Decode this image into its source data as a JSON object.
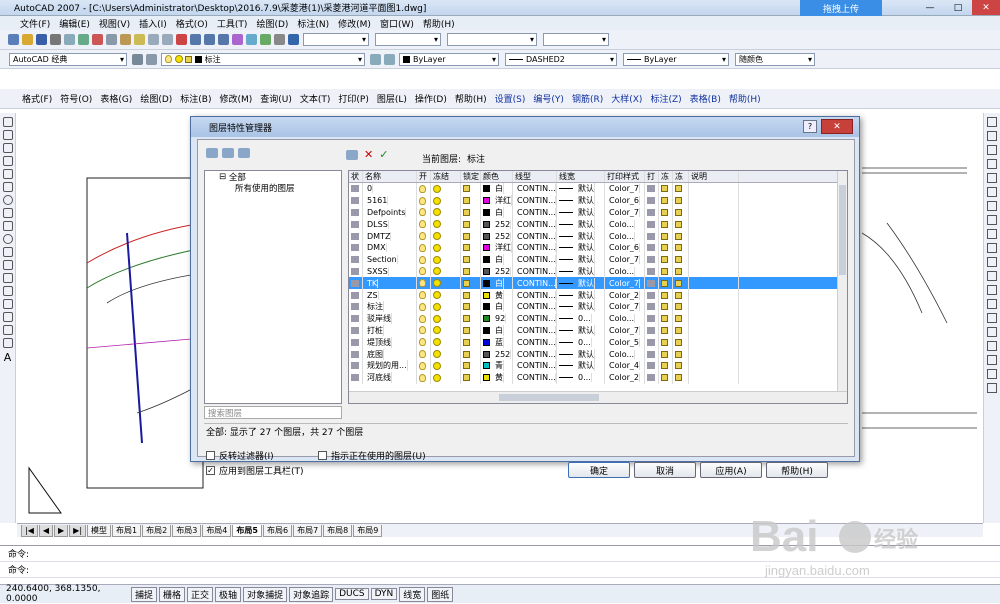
{
  "window": {
    "title": "AutoCAD 2007 - [C:\\Users\\Administrator\\Desktop\\2016.7.9\\采菱港(1)\\采菱港河道平面图1.dwg]",
    "upload_label": "拖拽上传",
    "controls": [
      "—",
      "□",
      "✕"
    ]
  },
  "menu": [
    "文件(F)",
    "编辑(E)",
    "视图(V)",
    "插入(I)",
    "格式(O)",
    "工具(T)",
    "绘图(D)",
    "标注(N)",
    "修改(M)",
    "窗口(W)",
    "帮助(H)"
  ],
  "toolbar2": {
    "workspace": "AutoCAD 经典",
    "layer": "标注",
    "color": "ByLayer",
    "linetype": "DASHED2",
    "lineweight": "ByLayer",
    "plotstyle": "随颜色"
  },
  "toolbar3": [
    "格式(F)",
    "符号(O)",
    "表格(G)",
    "绘图(D)",
    "标注(B)",
    "修改(M)",
    "查询(U)",
    "文本(T)",
    "打印(P)",
    "图层(L)",
    "操作(D)",
    "帮助(H)",
    "设置(S)",
    "编号(Y)",
    "钢筋(R)",
    "大样(X)",
    "标注(Z)",
    "表格(B)",
    "帮助(H)"
  ],
  "layout_tabs": [
    "模型",
    "布局1",
    "布局2",
    "布局3",
    "布局4",
    "布局5",
    "布局6",
    "布局7",
    "布局8",
    "布局9"
  ],
  "layout_nav": [
    "|◀",
    "◀",
    "▶",
    "▶|"
  ],
  "active_tab": "布局5",
  "command_lines": [
    "命令:",
    "命令:"
  ],
  "status": {
    "coords": "240.6400, 368.1350, 0.0000",
    "buttons": [
      "捕捉",
      "栅格",
      "正交",
      "极轴",
      "对象捕捉",
      "对象追踪",
      "DUCS",
      "DYN",
      "线宽",
      "图纸"
    ]
  },
  "dialog": {
    "title": "图层特性管理器",
    "help": "?",
    "close": "✕",
    "current_layer_label": "当前图层:",
    "current_layer": "标注",
    "tree": [
      "全部",
      "所有使用的图层"
    ],
    "search_placeholder": "搜索图层",
    "columns": [
      "状",
      "名称",
      "开",
      "冻结",
      "锁定",
      "颜色",
      "线型",
      "线宽",
      "打印样式",
      "打",
      "冻",
      "冻",
      "说明"
    ],
    "layers": [
      {
        "name": "0",
        "color": "白",
        "swatch": "#000000",
        "linetype": "CONTIN...",
        "lineweight": "默认",
        "plot": "Color_7"
      },
      {
        "name": "5161",
        "color": "洋红",
        "swatch": "#e000e0",
        "linetype": "CONTIN...",
        "lineweight": "默认",
        "plot": "Color_6"
      },
      {
        "name": "Defpoints",
        "color": "白",
        "swatch": "#000000",
        "linetype": "CONTIN...",
        "lineweight": "默认",
        "plot": "Color_7"
      },
      {
        "name": "DLSS",
        "color": "252",
        "swatch": "#555555",
        "linetype": "CONTIN...",
        "lineweight": "默认",
        "plot": "Colo..."
      },
      {
        "name": "DMTZ",
        "color": "252",
        "swatch": "#555555",
        "linetype": "CONTIN...",
        "lineweight": "默认",
        "plot": "Colo..."
      },
      {
        "name": "DMX",
        "color": "洋红",
        "swatch": "#e000e0",
        "linetype": "CONTIN...",
        "lineweight": "默认",
        "plot": "Color_6"
      },
      {
        "name": "Section",
        "color": "白",
        "swatch": "#000000",
        "linetype": "CONTIN...",
        "lineweight": "默认",
        "plot": "Color_7"
      },
      {
        "name": "SXSS",
        "color": "252",
        "swatch": "#555555",
        "linetype": "CONTIN...",
        "lineweight": "默认",
        "plot": "Colo..."
      },
      {
        "name": "TK",
        "color": "白",
        "swatch": "#000000",
        "linetype": "CONTIN...",
        "lineweight": "默认",
        "plot": "Color_7"
      },
      {
        "name": "ZS",
        "color": "黄",
        "swatch": "#e8e000",
        "linetype": "CONTIN...",
        "lineweight": "默认",
        "plot": "Color_2"
      },
      {
        "name": "标注",
        "color": "白",
        "swatch": "#000000",
        "linetype": "CONTIN...",
        "lineweight": "默认",
        "plot": "Color_7"
      },
      {
        "name": "驳岸线",
        "color": "92",
        "swatch": "#1f8a1f",
        "linetype": "CONTIN...",
        "lineweight": "0...",
        "plot": "Colo..."
      },
      {
        "name": "打桩",
        "color": "白",
        "swatch": "#000000",
        "linetype": "CONTIN...",
        "lineweight": "默认",
        "plot": "Color_7"
      },
      {
        "name": "堤顶线",
        "color": "蓝",
        "swatch": "#0000e0",
        "linetype": "CONTIN...",
        "lineweight": "0...",
        "plot": "Color_5"
      },
      {
        "name": "底图",
        "color": "252",
        "swatch": "#555555",
        "linetype": "CONTIN...",
        "lineweight": "默认",
        "plot": "Colo..."
      },
      {
        "name": "规划的用...",
        "color": "青",
        "swatch": "#00c0c0",
        "linetype": "CONTIN...",
        "lineweight": "默认",
        "plot": "Color_4"
      },
      {
        "name": "河底线",
        "color": "黄",
        "swatch": "#e8e000",
        "linetype": "CONTIN...",
        "lineweight": "0...",
        "plot": "Color_2"
      }
    ],
    "summary": "全部: 显示了 27 个图层，共 27 个图层",
    "invert_filter": "反转过滤器(I)",
    "indicate_used": "指示正在使用的图层(U)",
    "apply_toolbar": "应用到图层工具栏(T)",
    "ok": "确定",
    "cancel": "取消",
    "apply": "应用(A)",
    "help_btn": "帮助(H)"
  },
  "watermark": {
    "brand": "Bai",
    "mid": "经验",
    "url": "jingyan.baidu.com"
  }
}
